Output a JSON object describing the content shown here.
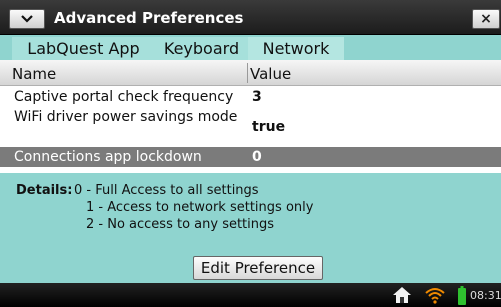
{
  "window": {
    "title": "Advanced Preferences",
    "close_label": "×"
  },
  "tabs": [
    {
      "label": "LabQuest App",
      "active": false
    },
    {
      "label": "Keyboard",
      "active": false
    },
    {
      "label": "Network",
      "active": true
    }
  ],
  "table": {
    "headers": {
      "name": "Name",
      "value": "Value"
    },
    "rows": [
      {
        "name": "Captive portal check frequency",
        "value": "3",
        "selected": false
      },
      {
        "name": "WiFi driver power savings mode",
        "value": "true",
        "selected": false
      },
      {
        "name": "Connections app lockdown",
        "value": "0",
        "selected": true
      }
    ]
  },
  "details": {
    "label": "Details:",
    "lines": [
      "0 - Full Access to all settings",
      "1 - Access to network settings only",
      "2 - No access to any settings"
    ]
  },
  "actions": {
    "edit_label": "Edit Preference"
  },
  "status": {
    "time": "08:31AM"
  },
  "colors": {
    "background": "#8fd4cf",
    "selected_row": "#7b7b7b",
    "titlebar": "#222222",
    "wifi": "#f08a00",
    "battery": "#2fc12f"
  }
}
